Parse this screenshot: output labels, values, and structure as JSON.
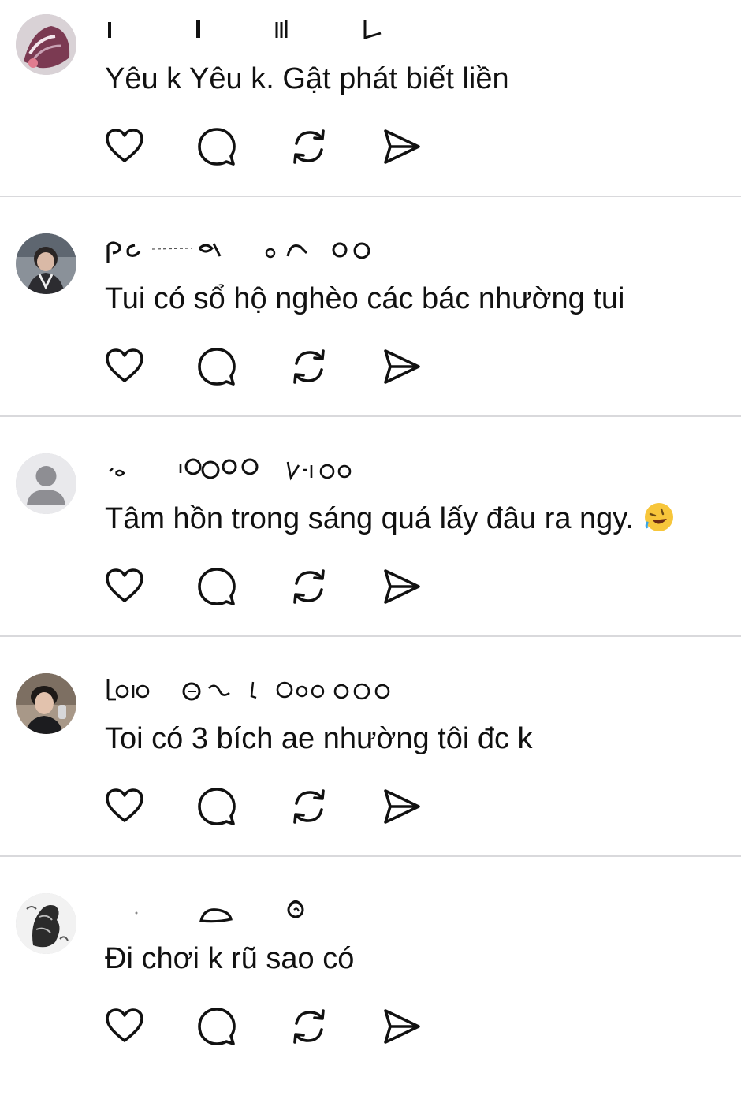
{
  "posts": [
    {
      "username": "",
      "text": "Yêu k Yêu k. Gật phát biết liền",
      "avatar": "photo-avatar"
    },
    {
      "username": "",
      "text": "Tui có sổ hộ nghèo các bác nhường tui",
      "avatar": "photo-avatar"
    },
    {
      "username": "",
      "text": "Tâm hồn trong sáng quá lấy đâu ra ngy.",
      "emoji": "rofl-emoji",
      "avatar": "default-avatar"
    },
    {
      "username": "",
      "text": "Toi có 3 bích ae nhường tôi đc k",
      "avatar": "photo-avatar"
    },
    {
      "username": "",
      "text": "Đi chơi k rũ sao có",
      "avatar": "photo-avatar"
    }
  ],
  "actions": [
    "heart-icon",
    "comment-icon",
    "repost-icon",
    "share-icon"
  ],
  "colors": {
    "text": "#111111",
    "divider": "#d9d9dc",
    "icon": "#111111",
    "default_avatar_bg": "#e9e9ec",
    "default_avatar_fg": "#8e8e93"
  }
}
